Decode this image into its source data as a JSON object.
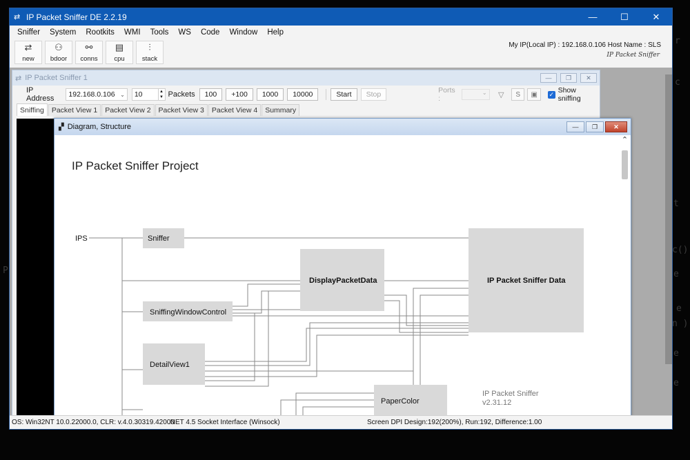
{
  "window": {
    "title": "IP Packet Sniffer DE 2.2.19",
    "controls": [
      "—",
      "☐",
      "✕"
    ]
  },
  "menu": [
    "Sniffer",
    "System",
    "Rootkits",
    "WMI",
    "Tools",
    "WS",
    "Code",
    "Window",
    "Help"
  ],
  "toolbar": {
    "buttons": [
      {
        "label": "new",
        "icon": "new-icon",
        "glyph": "⇄"
      },
      {
        "label": "bdoor",
        "icon": "bdoor-icon",
        "glyph": "⚇"
      },
      {
        "label": "conns",
        "icon": "conns-icon",
        "glyph": "⚯"
      },
      {
        "label": "cpu",
        "icon": "cpu-icon",
        "glyph": "▤"
      },
      {
        "label": "stack",
        "icon": "stack-icon",
        "glyph": "⫶"
      }
    ],
    "ip_info": "My IP(Local IP) : 192.168.0.106   Host Name : SLS",
    "logo": "IP Packet Sniffer"
  },
  "sniffer_window": {
    "title": "IP Packet Sniffer 1",
    "controls": [
      "—",
      "❐",
      "✕"
    ],
    "ip_label": "IP Address",
    "ip_value": "192.168.0.106",
    "packet_count": "10",
    "packets_label": "Packets",
    "count_buttons": [
      "100",
      "+100",
      "1000",
      "10000"
    ],
    "start_label": "Start",
    "stop_label": "Stop",
    "ports_label": "Ports :",
    "s_label": "S",
    "show_sniffing_label": "Show sniffing",
    "tabs": [
      "Sniffing",
      "Packet View 1",
      "Packet View 2",
      "Packet View 3",
      "Packet View 4",
      "Summary"
    ]
  },
  "diagram_window": {
    "title": "Diagram, Structure",
    "controls": [
      "—",
      "❐",
      "✕"
    ],
    "heading": "IP Packet Sniffer Project",
    "root_label": "IPS",
    "boxes": {
      "sniffer": "Sniffer",
      "display": "DisplayPacketData",
      "data": "IP Packet Sniffer Data",
      "swc": "SniffingWindowControl",
      "detail": "DetailView1",
      "paper": "PaperColor"
    },
    "version_name": "IP Packet Sniffer",
    "version": "v2.31.12"
  },
  "status": {
    "os": "OS: Win32NT 10.0.22000.0,  CLR: v.4.0.30319.42000",
    "net": ".NET 4.5 Socket Interface (Winsock)",
    "dpi": "Screen DPI Design:192(200%), Run:192, Difference:1.00"
  },
  "colors": {
    "titlebar": "#0f5bb5",
    "diagram_box": "#d9d9d9",
    "line": "#8a8a8a"
  }
}
